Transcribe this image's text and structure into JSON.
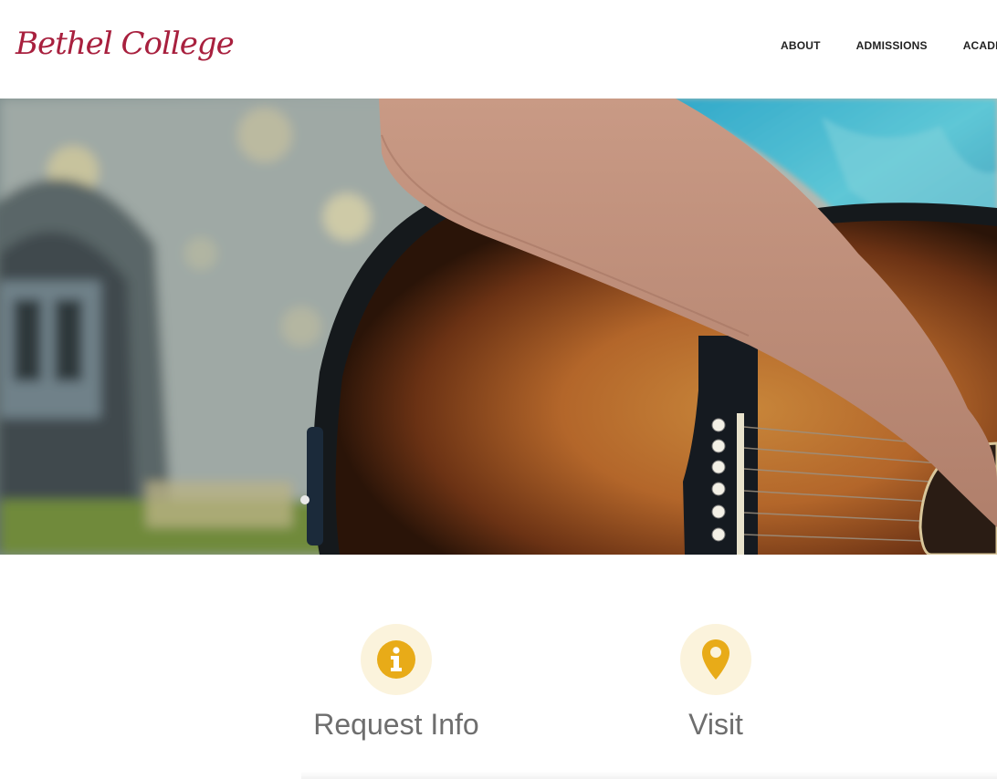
{
  "header": {
    "logo_text": "Bethel College",
    "nav": [
      {
        "label": "ABOUT"
      },
      {
        "label": "ADMISSIONS"
      },
      {
        "label": "ACADEMICS"
      }
    ]
  },
  "actions": [
    {
      "label": "Request Info",
      "icon": "info-icon"
    },
    {
      "label": "Visit",
      "icon": "map-pin-icon"
    }
  ],
  "colors": {
    "brand": "#a8203e",
    "icon_accent": "#e8ab18",
    "icon_background": "#fbf3dc",
    "action_text": "#6e6e6e"
  }
}
